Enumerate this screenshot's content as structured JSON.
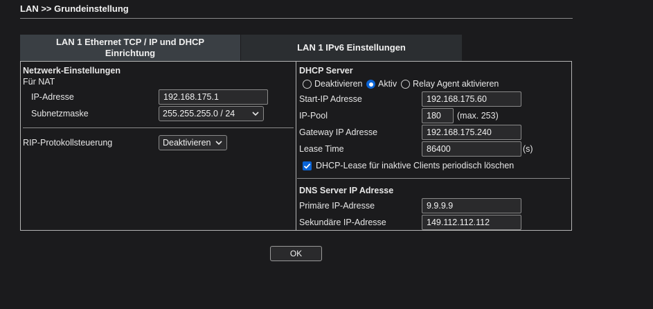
{
  "breadcrumb": "LAN >> Grundeinstellung",
  "tabs": {
    "tab1_line1": "LAN 1 Ethernet TCP / IP und DHCP",
    "tab1_line2": "Einrichtung",
    "tab2": "LAN 1 IPv6 Einstellungen"
  },
  "left": {
    "section_title": "Netzwerk-Einstellungen",
    "nat_label": "Für NAT",
    "ip_label": "IP-Adresse",
    "ip_value": "192.168.175.1",
    "subnet_label": "Subnetzmaske",
    "subnet_value": "255.255.255.0 / 24",
    "rip_label": "RIP-Protokollsteuerung",
    "rip_value": "Deaktivieren"
  },
  "dhcp": {
    "title": "DHCP Server",
    "mode_options": [
      "Deaktivieren",
      "Aktiv",
      "Relay Agent aktivieren"
    ],
    "selected_mode": "Aktiv",
    "start_ip_label": "Start-IP Adresse",
    "start_ip_value": "192.168.175.60",
    "pool_label": "IP-Pool",
    "pool_value": "180",
    "pool_max": "(max. 253)",
    "gateway_label": "Gateway IP Adresse",
    "gateway_value": "192.168.175.240",
    "lease_label": "Lease Time",
    "lease_value": "86400",
    "lease_unit": "(s)",
    "clear_lease_label": "DHCP-Lease für inaktive Clients periodisch löschen",
    "clear_lease_checked": true
  },
  "dns": {
    "title": "DNS Server IP Adresse",
    "primary_label": "Primäre IP-Adresse",
    "primary_value": "9.9.9.9",
    "secondary_label": "Sekundäre IP-Adresse",
    "secondary_value": "149.112.112.112"
  },
  "ok_label": "OK",
  "colors": {
    "accent": "#0a64d6",
    "background": "#1b1b1d",
    "active_tab": "#3a3f44"
  }
}
